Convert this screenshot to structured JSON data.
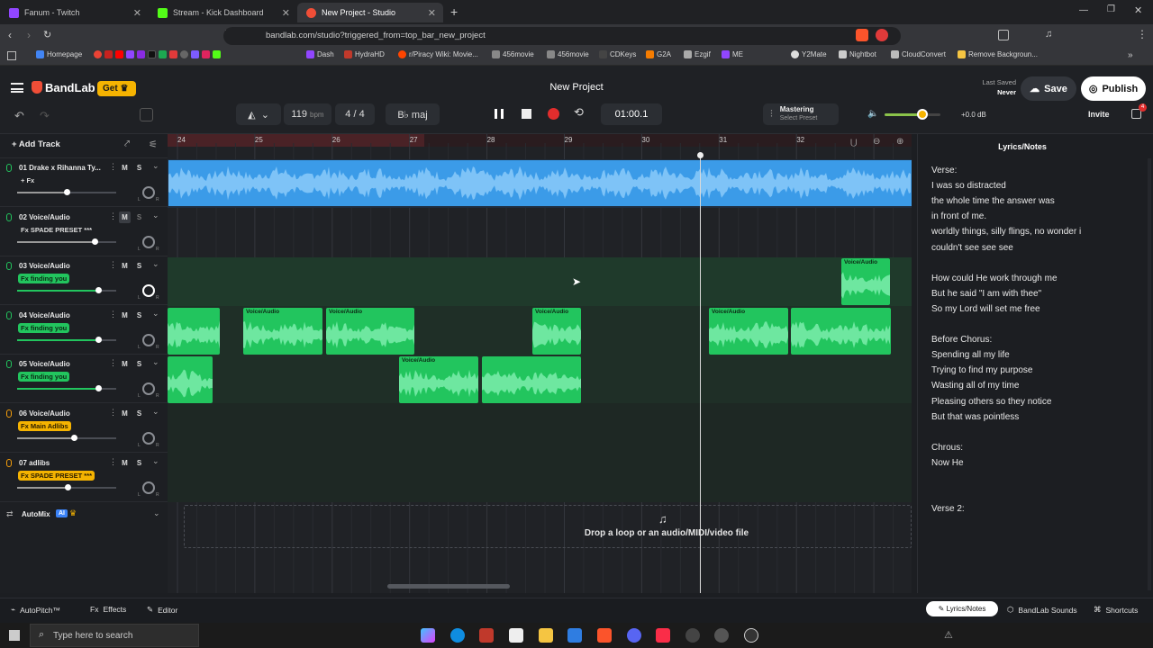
{
  "browser": {
    "tabs": [
      {
        "title": "Fanum - Twitch",
        "color": "#9146ff"
      },
      {
        "title": "Stream - Kick Dashboard",
        "color": "#53fc18"
      },
      {
        "title": "New Project - Studio",
        "color": "#f04e37"
      }
    ],
    "url": "bandlab.com/studio?triggered_from=top_bar_new_project",
    "bookmarks": [
      "Homepage",
      "Dash",
      "HydraHD",
      "r/Piracy Wiki: Movie...",
      "456movie",
      "456movie",
      "CDKeys",
      "G2A",
      "Ezgif",
      "ME",
      "Y2Mate",
      "Nightbot",
      "CloudConvert",
      "Remove Backgroun..."
    ]
  },
  "app": {
    "brand": "BandLab",
    "get_label": "Get",
    "project_title": "New Project",
    "last_saved_label": "Last Saved",
    "last_saved_value": "Never",
    "save_label": "Save",
    "publish_label": "Publish",
    "invite_label": "Invite",
    "notif_count": "4",
    "bpm": "119",
    "bpm_unit": "bpm",
    "time_sig_num": "4",
    "time_sig_sep": "/",
    "time_sig_den": "4",
    "key": "B♭ maj",
    "time": "01:00.1",
    "mastering_label": "Mastering",
    "mastering_preset": "Select Preset",
    "volume_db": "+0.0 dB",
    "add_track_label": "Add Track"
  },
  "ruler": [
    "24",
    "25",
    "26",
    "27",
    "28",
    "29",
    "30",
    "31",
    "32"
  ],
  "tracks": [
    {
      "num": "01",
      "name": "Drake x Rihanna Ty...",
      "fx": "+ Fx",
      "fx_style": "plain",
      "mic_color": "#22c55e",
      "vol": 0.5
    },
    {
      "num": "02",
      "name": "Voice/Audio",
      "fx": "Fx SPADE PRESET ***",
      "fx_style": "plain",
      "mic_color": "#22c55e",
      "vol": 0.78
    },
    {
      "num": "03",
      "name": "Voice/Audio",
      "fx": "Fx finding you",
      "fx_style": "green",
      "mic_color": "#22c55e",
      "vol": 0.82
    },
    {
      "num": "04",
      "name": "Voice/Audio",
      "fx": "Fx finding you",
      "fx_style": "green",
      "mic_color": "#22c55e",
      "vol": 0.82
    },
    {
      "num": "05",
      "name": "Voice/Audio",
      "fx": "Fx finding you",
      "fx_style": "green",
      "mic_color": "#22c55e",
      "vol": 0.82
    },
    {
      "num": "06",
      "name": "Voice/Audio",
      "fx": "Fx Main Adlibs",
      "fx_style": "yellow",
      "mic_color": "#f59e0b",
      "vol": 0.57
    },
    {
      "num": "07",
      "name": "adlibs",
      "fx": "Fx SPADE PRESET ***",
      "fx_style": "yellow",
      "mic_color": "#f59e0b",
      "vol": 0.51
    }
  ],
  "clip_label": "Voice/Audio",
  "automix_label": "AutoMix",
  "automix_ai": "AI",
  "drop_text": "Drop a loop or an audio/MIDI/video file",
  "lyrics": {
    "title": "Lyrics/Notes",
    "lines": [
      "Verse:",
      "I was so distracted",
      "the whole time the answer was",
      "in front of me.",
      "worldly things, silly flings, no wonder i",
      "couldn't see see see",
      "",
      "How could He work through me",
      "But he said \"I am with thee\"",
      "So my Lord will set me free",
      "",
      "Before Chorus:",
      "Spending all my life",
      "Trying to find my purpose",
      "Wasting all of my time",
      "Pleasing others so they notice",
      "But that was pointless",
      "",
      "Chrous:",
      "Now He",
      "",
      "",
      "Verse 2:"
    ]
  },
  "bottom": {
    "autopitch": "AutoPitch™",
    "effects": "Effects",
    "editor": "Editor",
    "lyrics_tab": "Lyrics/Notes",
    "sounds_tab": "BandLab Sounds",
    "shortcuts": "Shortcuts"
  },
  "taskbar": {
    "search_placeholder": "Type here to search"
  },
  "colors": {
    "accent": "#f04e37",
    "clip_green": "#22c55e",
    "clip_blue": "#3b9be8",
    "get_yellow": "#f5b301"
  }
}
